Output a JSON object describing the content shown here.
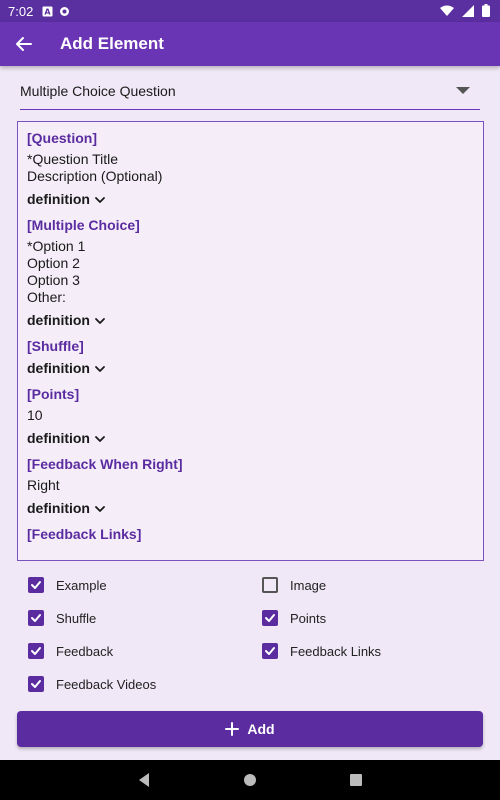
{
  "status_bar": {
    "time": "7:02",
    "left_icons": [
      "text-a-icon",
      "sync-icon"
    ],
    "right_icons": [
      "wifi-icon",
      "signal-icon",
      "battery-icon"
    ]
  },
  "app_bar": {
    "title": "Add Element",
    "back_icon": "arrow-left-icon"
  },
  "element_type": {
    "selected": "Multiple Choice Question"
  },
  "editor": {
    "definition_label": "definition",
    "sections": [
      {
        "header": "[Question]",
        "lines": [
          "*Question Title",
          "Description (Optional)"
        ]
      },
      {
        "header": "[Multiple Choice]",
        "lines": [
          "*Option 1",
          "Option 2",
          "Option 3",
          "Other:"
        ]
      },
      {
        "header": "[Shuffle]",
        "lines": []
      },
      {
        "header": "[Points]",
        "lines": [
          "10"
        ]
      },
      {
        "header": "[Feedback When Right]",
        "lines": [
          "Right"
        ]
      },
      {
        "header": "[Feedback Links]",
        "lines": []
      }
    ]
  },
  "options": [
    {
      "label": "Example",
      "checked": true
    },
    {
      "label": "Image",
      "checked": false
    },
    {
      "label": "Shuffle",
      "checked": true
    },
    {
      "label": "Points",
      "checked": true
    },
    {
      "label": "Feedback",
      "checked": true
    },
    {
      "label": "Feedback Links",
      "checked": true
    },
    {
      "label": "Feedback Videos",
      "checked": true
    }
  ],
  "add_button": {
    "label": "Add",
    "icon": "plus-icon"
  },
  "colors": {
    "primary": "#6a35b5",
    "accent": "#5b2ca0",
    "background": "#f0e8f6"
  }
}
